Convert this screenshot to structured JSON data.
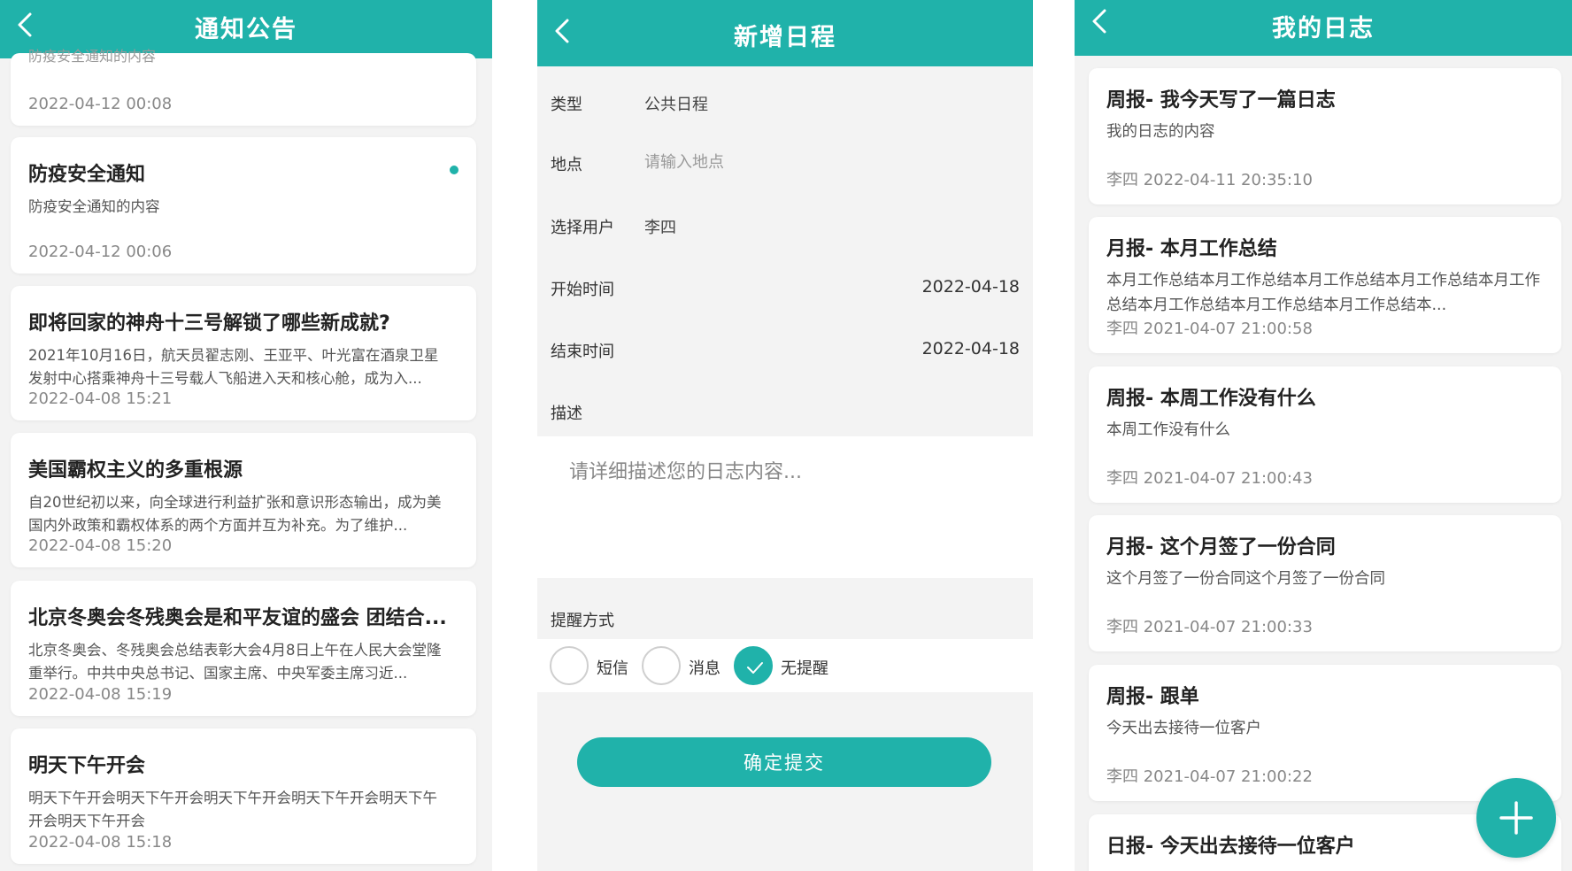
{
  "colors": {
    "accent": "#20b2aa",
    "background": "#f3f3f3",
    "card": "#ffffff"
  },
  "notices": {
    "title": "通知公告",
    "clipped_text": "防疫安全通知的内容",
    "items": [
      {
        "title": "",
        "body": "",
        "date": "2022-04-12 00:08",
        "unread": false
      },
      {
        "title": "防疫安全通知",
        "body": "防疫安全通知的内容",
        "date": "2022-04-12 00:06",
        "unread": true
      },
      {
        "title": "即将回家的神舟十三号解锁了哪些新成就?",
        "body": "2021年10月16日，航天员翟志刚、王亚平、叶光富在酒泉卫星发射中心搭乘神舟十三号载人飞船进入天和核心舱，成为入...",
        "date": "2022-04-08 15:21",
        "unread": false
      },
      {
        "title": "美国霸权主义的多重根源",
        "body": "自20世纪初以来，向全球进行利益扩张和意识形态输出，成为美国内外政策和霸权体系的两个方面并互为补充。为了维护...",
        "date": "2022-04-08 15:20",
        "unread": false
      },
      {
        "title": "北京冬奥会冬残奥会是和平友谊的盛会 团结合...",
        "body": "北京冬奥会、冬残奥会总结表彰大会4月8日上午在人民大会堂隆重举行。中共中央总书记、国家主席、中央军委主席习近...",
        "date": "2022-04-08 15:19",
        "unread": false
      },
      {
        "title": "明天下午开会",
        "body": "明天下午开会明天下午开会明天下午开会明天下午开会明天下午开会明天下午开会",
        "date": "2022-04-08 15:18",
        "unread": false
      }
    ]
  },
  "schedule": {
    "title": "新增日程",
    "type_label": "类型",
    "type_value": "公共日程",
    "location_label": "地点",
    "location_placeholder": "请输入地点",
    "user_label": "选择用户",
    "user_value": "李四",
    "start_label": "开始时间",
    "start_value": "2022-04-18",
    "end_label": "结束时间",
    "end_value": "2022-04-18",
    "desc_label": "描述",
    "desc_placeholder": "请详细描述您的日志内容...",
    "remind_label": "提醒方式",
    "remind_options": [
      {
        "label": "短信",
        "checked": false
      },
      {
        "label": "消息",
        "checked": false
      },
      {
        "label": "无提醒",
        "checked": true
      }
    ],
    "submit_label": "确定提交"
  },
  "logs": {
    "title": "我的日志",
    "items": [
      {
        "title": "周报- 我今天写了一篇日志",
        "body": "我的日志的内容",
        "meta": "李四 2022-04-11 20:35:10"
      },
      {
        "title": "月报- 本月工作总结",
        "body": "本月工作总结本月工作总结本月工作总结本月工作总结本月工作总结本月工作总结本月工作总结本月工作总结本...",
        "meta": "李四 2021-04-07 21:00:58"
      },
      {
        "title": "周报- 本周工作没有什么",
        "body": "本周工作没有什么",
        "meta": "李四 2021-04-07 21:00:43"
      },
      {
        "title": "月报- 这个月签了一份合同",
        "body": "这个月签了一份合同这个月签了一份合同",
        "meta": "李四 2021-04-07 21:00:33"
      },
      {
        "title": "周报- 跟单",
        "body": "今天出去接待一位客户",
        "meta": "李四 2021-04-07 21:00:22"
      },
      {
        "title": "日报- 今天出去接待一位客户",
        "body": "",
        "meta": ""
      }
    ],
    "fab_icon": "plus-icon"
  }
}
